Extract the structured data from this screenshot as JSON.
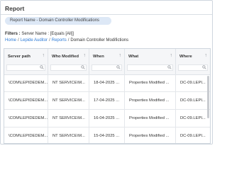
{
  "page": {
    "title": "Report",
    "report_name": "Report Name - Domain Controller Modifications",
    "filters_label": "Filters :",
    "filters_value": "Server Name : [Equals [All]]"
  },
  "breadcrumb": [
    {
      "label": "Home"
    },
    {
      "label": "Lepide Auditor"
    },
    {
      "label": "Reports"
    },
    {
      "label": "Domain Controller Modifictions"
    }
  ],
  "breadcrumb_separator": "/",
  "table": {
    "columns": [
      {
        "label": "Server path",
        "sort_icon": "sort-up-icon"
      },
      {
        "label": "Who Modified",
        "sort_icon": "sort-up-icon"
      },
      {
        "label": "When",
        "sort_icon": "sort-up-icon"
      },
      {
        "label": "What",
        "sort_icon": "sort-up-icon"
      },
      {
        "label": "Where",
        "sort_icon": "sort-up-icon"
      }
    ],
    "rows": [
      [
        "\\COM\\LEPIDEDEM...",
        "NT SERVICE\\M...",
        "18-04-2025 ...",
        "Properties Modified ...",
        "DC-09.LEPI..."
      ],
      [
        "\\COM\\LEPIDEDEM...",
        "NT SERVICE\\M...",
        "17-04-2025 ...",
        "Properties Modified ...",
        "DC-09.LEPI..."
      ],
      [
        "\\COM\\LEPIDEDEM...",
        "NT SERVICE\\M...",
        "16-04-2025 ...",
        "Properties Modified ...",
        "DC-09.LEPI..."
      ],
      [
        "\\COM\\LEPIDEDEM...",
        "NT SERVICE\\M...",
        "15-04-2025 ...",
        "Properties Modified ...",
        "DC-09.LEPI..."
      ]
    ]
  },
  "colors": {
    "link": "#2e7bd6",
    "pill_bg": "#dde8f6",
    "header_bg": "#f5f6f8"
  }
}
